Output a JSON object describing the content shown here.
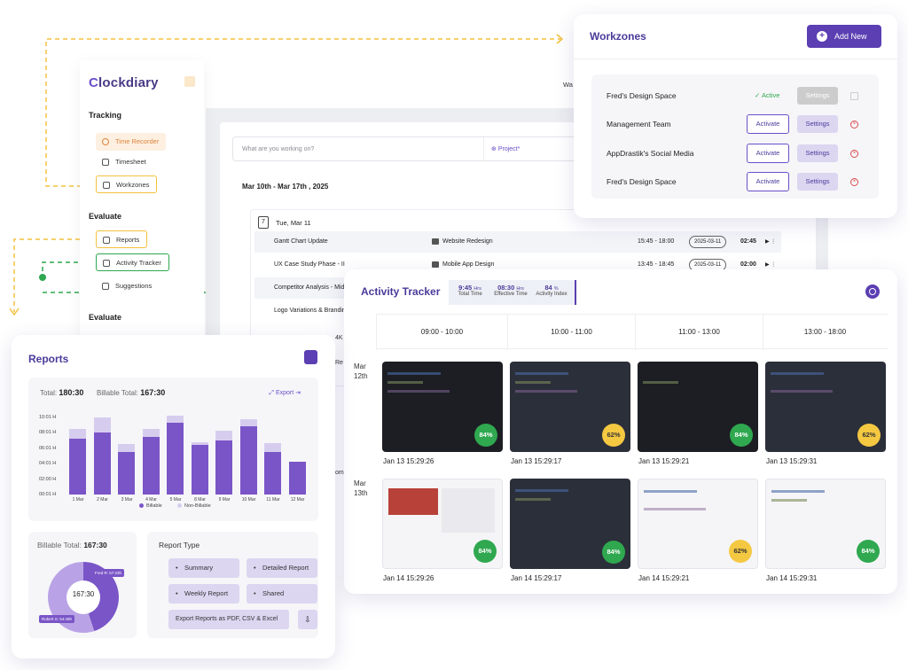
{
  "sidebar": {
    "logo_prefix": "C",
    "logo": "lockdiary",
    "tracking_heading": "Tracking",
    "items_tracking": [
      "Time Recorder",
      "Timesheet",
      "Workzones"
    ],
    "evaluate_heading": "Evaluate",
    "items_evaluate": [
      "Reports",
      "Activity Tracker",
      "Suggestions"
    ],
    "evaluate_heading_2": "Evaluate"
  },
  "header": {
    "user_fragment": "Wa"
  },
  "timesheet": {
    "input_placeholder": "What are you working on?",
    "project_label": "Project",
    "project_required": "*",
    "date_range": "Mar 10th - Mar 17th  , 2025",
    "day_number": "7",
    "day_name": "Tue, Mar 11",
    "rows": [
      {
        "task": "Gantt Chart Update",
        "project": "Website Redesign",
        "time": "15:45 - 18:00",
        "date": "2025-03-11",
        "duration": "02:45"
      },
      {
        "task": "UX Case Study Phase - II",
        "project": "Mobile App Design",
        "time": "13:45 - 18:45",
        "date": "2025-03-11",
        "duration": "02:00"
      },
      {
        "task": "Competitor Analysis - Mid"
      },
      {
        "task": "Logo Variations & Branding"
      }
    ],
    "fragments": [
      "4K",
      "Re",
      "om"
    ]
  },
  "workzones": {
    "title": "Workzones",
    "add_label": "Add New",
    "active_label": "Active",
    "activate_label": "Activate",
    "settings_label": "Settings",
    "rows": [
      "Fred's Design Space",
      "Management Team",
      "AppDrastik's Social Media",
      "Fred's Design Space"
    ]
  },
  "activity": {
    "title": "Activity Tracker",
    "stats": [
      {
        "value": "9:45",
        "unit": "Hrs",
        "label": "Total Time"
      },
      {
        "value": "08:30",
        "unit": "Hrs",
        "label": "Effective Time"
      },
      {
        "value": "84",
        "unit": "%",
        "label": "Activity Index"
      }
    ],
    "columns": [
      "09:00 - 10:00",
      "10:00 - 11:00",
      "11:00 - 13:00",
      "13:00 - 18:00"
    ],
    "days": [
      {
        "label": "Mar 12th",
        "shots": [
          {
            "pct": "84%",
            "ts": "Jan 13 15:29:26"
          },
          {
            "pct": "62%",
            "ts": "Jan 13 15:29:17"
          },
          {
            "pct": "84%",
            "ts": "Jan 13 15:29:21"
          },
          {
            "pct": "62%",
            "ts": "Jan 13 15:29:31"
          }
        ]
      },
      {
        "label": "Mar 13th",
        "shots": [
          {
            "pct": "84%",
            "ts": "Jan 14 15:29:26"
          },
          {
            "pct": "84%",
            "ts": "Jan 14 15:29:17"
          },
          {
            "pct": "62%",
            "ts": "Jan 14 15:29:21"
          },
          {
            "pct": "84%",
            "ts": "Jan 14 15:29:31"
          }
        ]
      }
    ]
  },
  "reports": {
    "title": "Reports",
    "total_label": "Total:",
    "total_value": "180:30",
    "billable_total_label": "Billable Total:",
    "billable_total_value": "167:30",
    "export_label": "Export",
    "legend": [
      "Billable",
      "Non-Billable"
    ],
    "billable_total_label_2": "Billable Total:",
    "billable_total_value_2": "167:30",
    "donut_center": "167:30",
    "tip1": "Fred R: 57:23h",
    "tip2": "Robert S: 54:49h",
    "report_type_title": "Report Type",
    "report_types": [
      "Summary",
      "Detailed Report",
      "Weekly Report",
      "Shared"
    ],
    "export_formats": "Export Reports as PDF, CSV & Excel",
    "colors": {
      "billable": "#7a55c7",
      "non_billable": "#d6cdee",
      "accent": "#5b3fb3"
    }
  },
  "chart_data": {
    "type": "bar",
    "categories": [
      "1 Mar",
      "2 Mar",
      "3 Mar",
      "4 Mar",
      "5 Mar",
      "8 Mar",
      "9 Mar",
      "10 Mar",
      "11 Mar",
      "12 Mar"
    ],
    "series": [
      {
        "name": "Billable",
        "values": [
          7.2,
          8.0,
          5.5,
          7.5,
          9.3,
          6.4,
          7.0,
          8.9,
          5.5,
          4.3
        ]
      },
      {
        "name": "Non-Billable",
        "values": [
          1.3,
          2.0,
          1.1,
          1.0,
          0.9,
          0.4,
          1.3,
          0.9,
          1.2,
          0.0
        ]
      }
    ],
    "y_ticks": [
      "10:01 H",
      "08:01 H",
      "06:01 H",
      "04:01 H",
      "02:00 H",
      "00:01 H"
    ],
    "ylim": [
      0,
      10
    ],
    "stacked": true,
    "legend_position": "bottom"
  }
}
